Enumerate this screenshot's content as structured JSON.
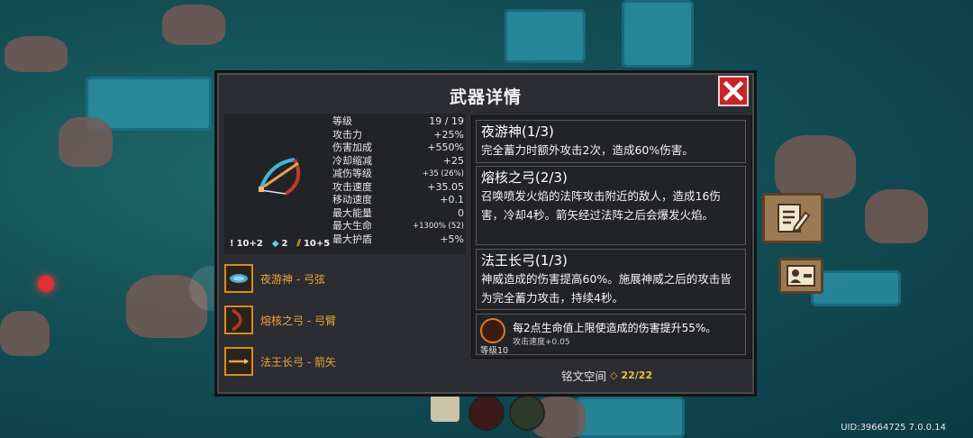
{
  "panel": {
    "title": "武器详情"
  },
  "weapon": {
    "stats": [
      {
        "label": "等级",
        "value": "19 / 19"
      },
      {
        "label": "攻击力",
        "value": "+25%"
      },
      {
        "label": "伤害加成",
        "value": "+550%"
      },
      {
        "label": "冷却缩减",
        "value": "+25"
      },
      {
        "label": "减伤等级",
        "value": "+35 (26%)"
      },
      {
        "label": "攻击速度",
        "value": "+35.05"
      },
      {
        "label": "移动速度",
        "value": "+0.1"
      },
      {
        "label": "最大能量",
        "value": "0"
      },
      {
        "label": "最大生命",
        "value": "+1300% (52)"
      },
      {
        "label": "最大护盾",
        "value": "+5%"
      }
    ],
    "badges": [
      "10+2",
      "2",
      "10+5"
    ]
  },
  "parts": [
    {
      "label": "夜游神 - 弓弦",
      "icon": "bowstring-icon"
    },
    {
      "label": "熔核之弓 - 弓臂",
      "icon": "bow-limb-icon"
    },
    {
      "label": "法王长弓 - 箭矢",
      "icon": "arrow-icon"
    }
  ],
  "descriptions": [
    {
      "name": "夜游神(1/3)",
      "text": "完全蓄力时额外攻击2次，造成60%伤害。"
    },
    {
      "name": "熔核之弓(2/3)",
      "text": "召唤喷发火焰的法阵攻击附近的敌人，造成16伤害，冷却4秒。箭矢经过法阵之后会爆发火焰。"
    },
    {
      "name": "法王长弓(1/3)",
      "text": "神威造成的伤害提高60%。施展神威之后的攻击皆为完全蓄力攻击，持续4秒。"
    }
  ],
  "rune": {
    "text": "每2点生命值上限使造成的伤害提升55%。",
    "sub": "攻击速度+0.05",
    "level": "等级10"
  },
  "rune_space": {
    "label": "铭文空间",
    "count": "22/22"
  },
  "uid": "UID:39664725 7.0.0.14",
  "colors": {
    "panel": "#2c2d32",
    "accent_orange": "#f0a33a",
    "close_red": "#c8252a"
  }
}
